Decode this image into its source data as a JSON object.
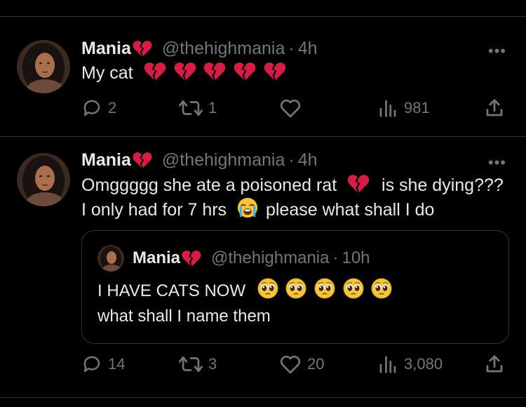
{
  "tweets": [
    {
      "name": "Mania",
      "handle": "@thehighmania",
      "time": "4h",
      "text_lines": [
        "My cat"
      ],
      "replies": "2",
      "retweets": "1",
      "likes": "",
      "views": "981"
    },
    {
      "name": "Mania",
      "handle": "@thehighmania",
      "time": "4h",
      "line1_a": "Omggggg she ate a poisoned rat",
      "line1_b": "is she dying???",
      "line2_a": "I only had for 7 hrs",
      "line2_b": "please what shall I do",
      "replies": "14",
      "retweets": "3",
      "likes": "20",
      "views": "3,080",
      "quote": {
        "name": "Mania",
        "handle": "@thehighmania",
        "time": "10h",
        "line1": "I HAVE CATS NOW",
        "line2": "what shall I name them"
      }
    }
  ],
  "more_label": "•••",
  "dot": "·",
  "icons": {
    "broken_heart": "broken-heart-emoji",
    "crying": "crying-face-emoji",
    "pleading": "pleading-face-emoji",
    "reply": "reply-icon",
    "retweet": "retweet-icon",
    "like": "heart-icon",
    "views": "views-icon",
    "share": "share-icon"
  },
  "colors": {
    "background": "#000000",
    "text": "#e7e9ea",
    "secondary": "#71767b",
    "border": "#2f3336",
    "broken_heart": "#e0245e"
  }
}
